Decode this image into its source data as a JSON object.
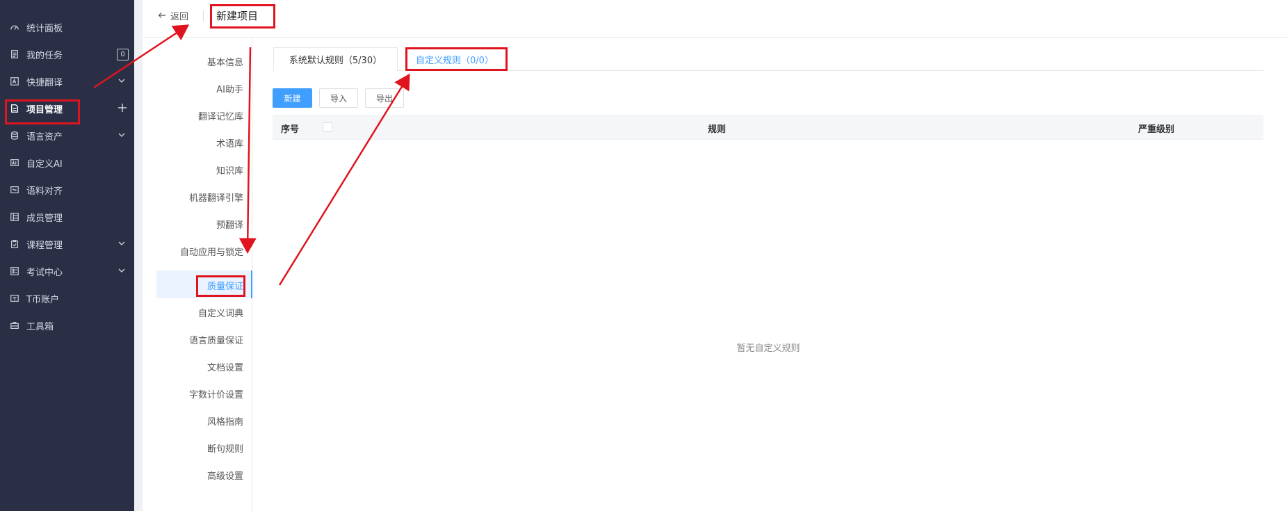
{
  "sidebar": {
    "items": [
      {
        "label": "统计面板",
        "icon": "dashboard-icon"
      },
      {
        "label": "我的任务",
        "icon": "task-icon",
        "badge": "0"
      },
      {
        "label": "快捷翻译",
        "icon": "translate-icon"
      },
      {
        "label": "项目管理",
        "icon": "project-icon"
      },
      {
        "label": "语言资产",
        "icon": "database-icon"
      },
      {
        "label": "自定义AI",
        "icon": "ai-icon"
      },
      {
        "label": "语料对齐",
        "icon": "align-icon"
      },
      {
        "label": "成员管理",
        "icon": "members-icon"
      },
      {
        "label": "课程管理",
        "icon": "course-icon"
      },
      {
        "label": "考试中心",
        "icon": "exam-icon"
      },
      {
        "label": "T币账户",
        "icon": "wallet-icon"
      },
      {
        "label": "工具箱",
        "icon": "toolbox-icon"
      }
    ]
  },
  "header": {
    "back_label": "返回",
    "title": "新建项目"
  },
  "subnav": {
    "items": [
      {
        "label": "基本信息"
      },
      {
        "label": "AI助手"
      },
      {
        "label": "翻译记忆库"
      },
      {
        "label": "术语库"
      },
      {
        "label": "知识库"
      },
      {
        "label": "机器翻译引擎"
      },
      {
        "label": "预翻译"
      },
      {
        "label": "自动应用与锁定"
      },
      {
        "label": "质量保证"
      },
      {
        "label": "自定义词典"
      },
      {
        "label": "语言质量保证"
      },
      {
        "label": "文档设置"
      },
      {
        "label": "字数计价设置"
      },
      {
        "label": "风格指南"
      },
      {
        "label": "断句规则"
      },
      {
        "label": "高级设置"
      }
    ]
  },
  "tabs": [
    {
      "label": "系统默认规则（5/30）"
    },
    {
      "label": "自定义规则（0/0）"
    }
  ],
  "toolbar": {
    "new_label": "新建",
    "import_label": "导入",
    "export_label": "导出"
  },
  "table": {
    "columns": [
      "序号",
      "规则",
      "严重级别"
    ],
    "empty_text": "暂无自定义规则"
  },
  "colors": {
    "sidebar_bg": "#2b2f45",
    "accent": "#409eff",
    "annotation_red": "#e0141e"
  }
}
